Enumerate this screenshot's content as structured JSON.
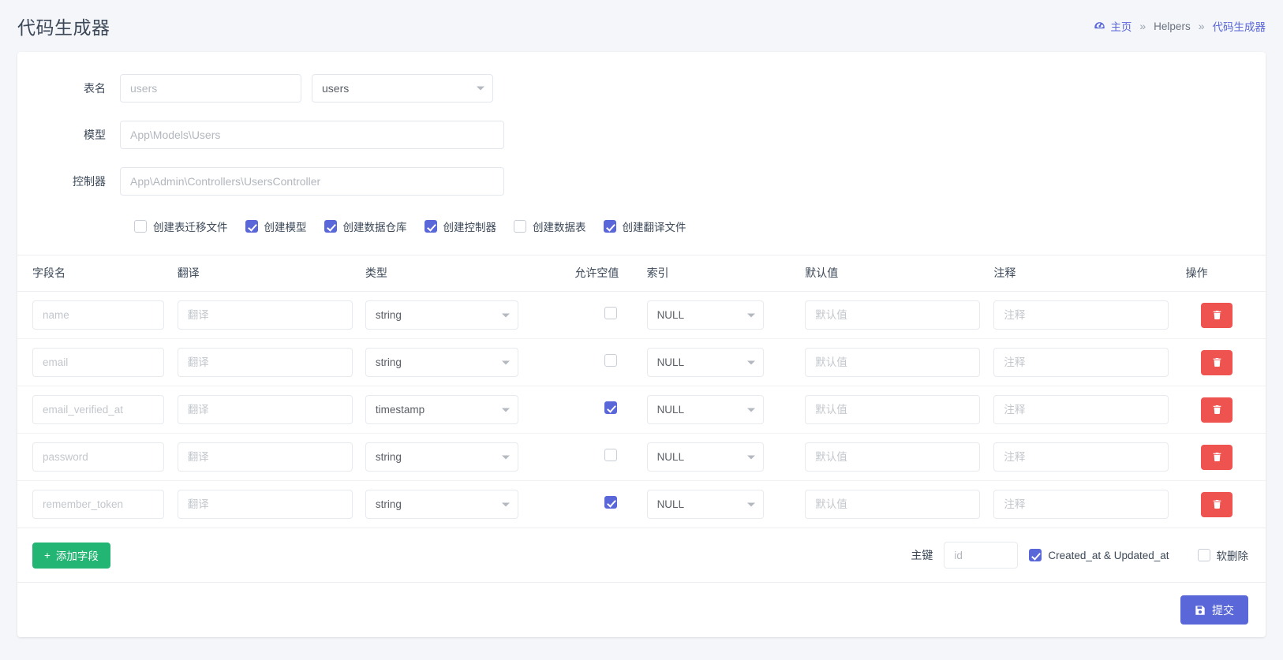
{
  "header": {
    "title": "代码生成器",
    "breadcrumb": {
      "home_icon": "dashboard-icon",
      "home": "主页",
      "sep1": "»",
      "middle": "Helpers",
      "sep2": "»",
      "current": "代码生成器"
    }
  },
  "form": {
    "table_name_label": "表名",
    "table_name_value": "users",
    "table_select_value": "users",
    "model_label": "模型",
    "model_value": "App\\Models\\Users",
    "controller_label": "控制器",
    "controller_value": "App\\Admin\\Controllers\\UsersController",
    "options": [
      {
        "label": "创建表迁移文件",
        "checked": false
      },
      {
        "label": "创建模型",
        "checked": true
      },
      {
        "label": "创建数据仓库",
        "checked": true
      },
      {
        "label": "创建控制器",
        "checked": true
      },
      {
        "label": "创建数据表",
        "checked": false
      },
      {
        "label": "创建翻译文件",
        "checked": true
      }
    ]
  },
  "table": {
    "columns": {
      "name": "字段名",
      "translation": "翻译",
      "type": "类型",
      "nullable": "允许空值",
      "index": "索引",
      "default": "默认值",
      "comment": "注释",
      "action": "操作"
    },
    "placeholders": {
      "translation": "翻译",
      "default": "默认值",
      "comment": "注释"
    },
    "delete_icon": "trash-icon",
    "rows": [
      {
        "name": "name",
        "translation": "",
        "type": "string",
        "nullable": false,
        "index": "NULL",
        "default": "",
        "comment": ""
      },
      {
        "name": "email",
        "translation": "",
        "type": "string",
        "nullable": false,
        "index": "NULL",
        "default": "",
        "comment": ""
      },
      {
        "name": "email_verified_at",
        "translation": "",
        "type": "timestamp",
        "nullable": true,
        "index": "NULL",
        "default": "",
        "comment": ""
      },
      {
        "name": "password",
        "translation": "",
        "type": "string",
        "nullable": false,
        "index": "NULL",
        "default": "",
        "comment": ""
      },
      {
        "name": "remember_token",
        "translation": "",
        "type": "string",
        "nullable": true,
        "index": "NULL",
        "default": "",
        "comment": ""
      }
    ]
  },
  "footer": {
    "add_field_icon": "plus-icon",
    "add_field_label": "添加字段",
    "primary_key_label": "主键",
    "primary_key_value": "id",
    "timestamps_label": "Created_at & Updated_at",
    "timestamps_checked": true,
    "softdelete_label": "软删除",
    "softdelete_checked": false
  },
  "submit": {
    "icon": "save-icon",
    "label": "提交"
  },
  "colors": {
    "accent": "#5a67d8",
    "success": "#22b573",
    "danger": "#ef5350",
    "page_bg": "#f4f6f9",
    "text": "#3c4858"
  }
}
